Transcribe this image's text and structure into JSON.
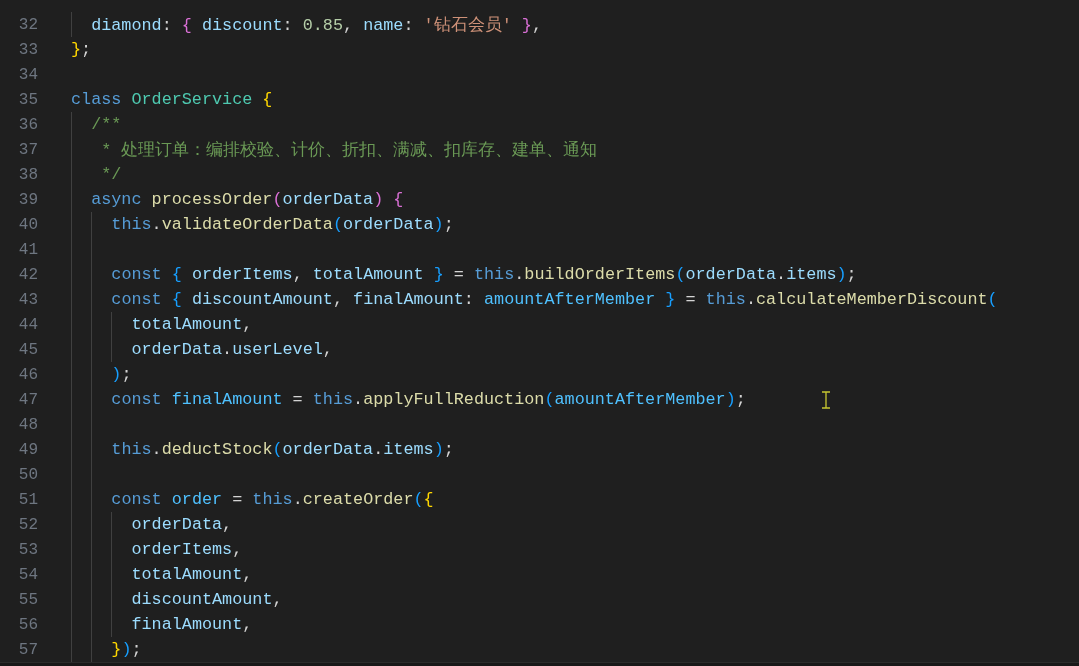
{
  "editor": {
    "lines": [
      {
        "children": [
          {
            "number": "32",
            "tokens": [
              {
                "kind": "var",
                "text": "diamond"
              },
              {
                "kind": "punct",
                "text": ": "
              },
              {
                "kind": "bracket",
                "text": "{ ",
                "color": "#da70d6"
              },
              {
                "kind": "var",
                "text": "discount"
              },
              {
                "kind": "punct",
                "text": ": "
              },
              {
                "kind": "num",
                "text": "0.85"
              },
              {
                "kind": "punct",
                "text": ", "
              },
              {
                "kind": "var",
                "text": "name"
              },
              {
                "kind": "punct",
                "text": ": "
              },
              {
                "kind": "str",
                "text": "'钻石会员' "
              },
              {
                "kind": "bracket",
                "text": "}",
                "color": "#da70d6"
              },
              {
                "kind": "punct",
                "text": ","
              }
            ]
          }
        ]
      },
      {
        "number": "33",
        "tokens": [
          {
            "kind": "bracket",
            "text": "}",
            "color": "#ffd700"
          },
          {
            "kind": "punct",
            "text": ";"
          }
        ]
      },
      {
        "number": "34"
      },
      {
        "number": "35",
        "tokens": [
          {
            "kind": "kw",
            "text": "class "
          },
          {
            "kind": "type",
            "text": "OrderService "
          },
          {
            "kind": "bracket",
            "text": "{",
            "color": "#ffd700"
          }
        ],
        "children": [
          {
            "number": "36",
            "tokens": [
              {
                "kind": "comment",
                "text": "/**"
              }
            ]
          },
          {
            "number": "37",
            "tokens": [
              {
                "kind": "comment",
                "text": " * 处理订单：编排校验、计价、折扣、满减、扣库存、建单、通知"
              }
            ]
          },
          {
            "number": "38",
            "tokens": [
              {
                "kind": "comment",
                "text": " */"
              }
            ]
          },
          {
            "number": "39",
            "tokens": [
              {
                "kind": "kw",
                "text": "async "
              },
              {
                "kind": "fn",
                "text": "processOrder"
              },
              {
                "kind": "bracket",
                "text": "(",
                "color": "#da70d6"
              },
              {
                "kind": "var",
                "text": "orderData"
              },
              {
                "kind": "bracket",
                "text": ") ",
                "color": "#da70d6"
              },
              {
                "kind": "bracket",
                "text": "{",
                "color": "#da70d6"
              }
            ],
            "children": [
              {
                "number": "40",
                "tokens": [
                  {
                    "kind": "kw",
                    "text": "this"
                  },
                  {
                    "kind": "punct",
                    "text": "."
                  },
                  {
                    "kind": "fn",
                    "text": "validateOrderData"
                  },
                  {
                    "kind": "bracket",
                    "text": "(",
                    "color": "#179fff"
                  },
                  {
                    "kind": "var",
                    "text": "orderData"
                  },
                  {
                    "kind": "bracket",
                    "text": ")",
                    "color": "#179fff"
                  },
                  {
                    "kind": "punct",
                    "text": ";"
                  }
                ]
              },
              {
                "number": "41"
              },
              {
                "number": "42",
                "tokens": [
                  {
                    "kind": "kw",
                    "text": "const "
                  },
                  {
                    "kind": "bracket",
                    "text": "{ ",
                    "color": "#179fff"
                  },
                  {
                    "kind": "var",
                    "text": "orderItems"
                  },
                  {
                    "kind": "punct",
                    "text": ", "
                  },
                  {
                    "kind": "var",
                    "text": "totalAmount "
                  },
                  {
                    "kind": "bracket",
                    "text": "}",
                    "color": "#179fff"
                  },
                  {
                    "kind": "punct",
                    "text": " = "
                  },
                  {
                    "kind": "kw",
                    "text": "this"
                  },
                  {
                    "kind": "punct",
                    "text": "."
                  },
                  {
                    "kind": "fn",
                    "text": "buildOrderItems"
                  },
                  {
                    "kind": "bracket",
                    "text": "(",
                    "color": "#179fff"
                  },
                  {
                    "kind": "var",
                    "text": "orderData"
                  },
                  {
                    "kind": "punct",
                    "text": "."
                  },
                  {
                    "kind": "var",
                    "text": "items"
                  },
                  {
                    "kind": "bracket",
                    "text": ")",
                    "color": "#179fff"
                  },
                  {
                    "kind": "punct",
                    "text": ";"
                  }
                ]
              },
              {
                "number": "43",
                "tokens": [
                  {
                    "kind": "kw",
                    "text": "const "
                  },
                  {
                    "kind": "bracket",
                    "text": "{ ",
                    "color": "#179fff"
                  },
                  {
                    "kind": "var",
                    "text": "discountAmount"
                  },
                  {
                    "kind": "punct",
                    "text": ", "
                  },
                  {
                    "kind": "var",
                    "text": "finalAmount"
                  },
                  {
                    "kind": "punct",
                    "text": ": "
                  },
                  {
                    "kind": "const",
                    "text": "amountAfterMember "
                  },
                  {
                    "kind": "bracket",
                    "text": "}",
                    "color": "#179fff"
                  },
                  {
                    "kind": "punct",
                    "text": " = "
                  },
                  {
                    "kind": "kw",
                    "text": "this"
                  },
                  {
                    "kind": "punct",
                    "text": "."
                  },
                  {
                    "kind": "fn",
                    "text": "calculateMemberDiscount"
                  },
                  {
                    "kind": "bracket",
                    "text": "(",
                    "color": "#179fff"
                  }
                ],
                "children": [
                  {
                    "number": "44",
                    "tokens": [
                      {
                        "kind": "var",
                        "text": "totalAmount"
                      },
                      {
                        "kind": "punct",
                        "text": ","
                      }
                    ]
                  },
                  {
                    "number": "45",
                    "tokens": [
                      {
                        "kind": "var",
                        "text": "orderData"
                      },
                      {
                        "kind": "punct",
                        "text": "."
                      },
                      {
                        "kind": "var",
                        "text": "userLevel"
                      },
                      {
                        "kind": "punct",
                        "text": ","
                      }
                    ]
                  }
                ]
              },
              {
                "number": "46",
                "tokens": [
                  {
                    "kind": "bracket",
                    "text": ")",
                    "color": "#179fff"
                  },
                  {
                    "kind": "punct",
                    "text": ";"
                  }
                ]
              },
              {
                "number": "47",
                "tokens": [
                  {
                    "kind": "kw",
                    "text": "const "
                  },
                  {
                    "kind": "const",
                    "text": "finalAmount"
                  },
                  {
                    "kind": "punct",
                    "text": " = "
                  },
                  {
                    "kind": "kw",
                    "text": "this"
                  },
                  {
                    "kind": "punct",
                    "text": "."
                  },
                  {
                    "kind": "fn",
                    "text": "applyFullReduction"
                  },
                  {
                    "kind": "bracket",
                    "text": "(",
                    "color": "#179fff"
                  },
                  {
                    "kind": "const",
                    "text": "amountAfterMember"
                  },
                  {
                    "kind": "bracket",
                    "text": ")",
                    "color": "#179fff"
                  },
                  {
                    "kind": "punct",
                    "text": ";"
                  }
                ]
              },
              {
                "number": "48"
              },
              {
                "number": "49",
                "tokens": [
                  {
                    "kind": "kw",
                    "text": "this"
                  },
                  {
                    "kind": "punct",
                    "text": "."
                  },
                  {
                    "kind": "fn",
                    "text": "deductStock"
                  },
                  {
                    "kind": "bracket",
                    "text": "(",
                    "color": "#179fff"
                  },
                  {
                    "kind": "var",
                    "text": "orderData"
                  },
                  {
                    "kind": "punct",
                    "text": "."
                  },
                  {
                    "kind": "var",
                    "text": "items"
                  },
                  {
                    "kind": "bracket",
                    "text": ")",
                    "color": "#179fff"
                  },
                  {
                    "kind": "punct",
                    "text": ";"
                  }
                ]
              },
              {
                "number": "50"
              },
              {
                "number": "51",
                "tokens": [
                  {
                    "kind": "kw",
                    "text": "const "
                  },
                  {
                    "kind": "const",
                    "text": "order"
                  },
                  {
                    "kind": "punct",
                    "text": " = "
                  },
                  {
                    "kind": "kw",
                    "text": "this"
                  },
                  {
                    "kind": "punct",
                    "text": "."
                  },
                  {
                    "kind": "fn",
                    "text": "createOrder"
                  },
                  {
                    "kind": "bracket",
                    "text": "(",
                    "color": "#179fff"
                  },
                  {
                    "kind": "bracket",
                    "text": "{",
                    "color": "#ffd700"
                  }
                ],
                "children": [
                  {
                    "number": "52",
                    "tokens": [
                      {
                        "kind": "var",
                        "text": "orderData"
                      },
                      {
                        "kind": "punct",
                        "text": ","
                      }
                    ]
                  },
                  {
                    "number": "53",
                    "tokens": [
                      {
                        "kind": "var",
                        "text": "orderItems"
                      },
                      {
                        "kind": "punct",
                        "text": ","
                      }
                    ]
                  },
                  {
                    "number": "54",
                    "tokens": [
                      {
                        "kind": "var",
                        "text": "totalAmount"
                      },
                      {
                        "kind": "punct",
                        "text": ","
                      }
                    ]
                  },
                  {
                    "number": "55",
                    "tokens": [
                      {
                        "kind": "var",
                        "text": "discountAmount"
                      },
                      {
                        "kind": "punct",
                        "text": ","
                      }
                    ]
                  },
                  {
                    "number": "56",
                    "tokens": [
                      {
                        "kind": "var",
                        "text": "finalAmount"
                      },
                      {
                        "kind": "punct",
                        "text": ","
                      }
                    ]
                  }
                ]
              },
              {
                "number": "57",
                "tokens": [
                  {
                    "kind": "bracket",
                    "text": "}",
                    "color": "#ffd700"
                  },
                  {
                    "kind": "bracket",
                    "text": ")",
                    "color": "#179fff"
                  },
                  {
                    "kind": "punct",
                    "text": ";"
                  }
                ]
              }
            ]
          }
        ]
      }
    ]
  }
}
